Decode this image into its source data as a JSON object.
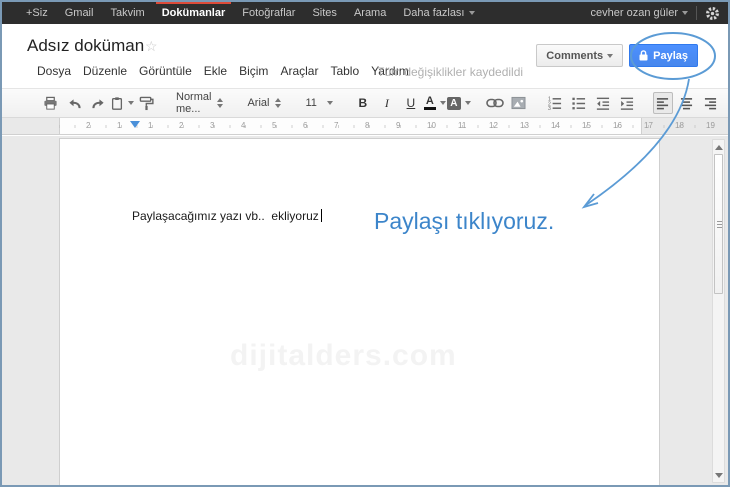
{
  "topbar": {
    "items": [
      {
        "label": "+Siz",
        "active": false,
        "caret": false
      },
      {
        "label": "Gmail",
        "active": false,
        "caret": false
      },
      {
        "label": "Takvim",
        "active": false,
        "caret": false
      },
      {
        "label": "Dokümanlar",
        "active": true,
        "caret": false
      },
      {
        "label": "Fotoğraflar",
        "active": false,
        "caret": false
      },
      {
        "label": "Sites",
        "active": false,
        "caret": false
      },
      {
        "label": "Arama",
        "active": false,
        "caret": false
      },
      {
        "label": "Daha fazlası",
        "active": false,
        "caret": true
      }
    ],
    "user_name": "cevher ozan güler",
    "gear_icon": "settings-gear"
  },
  "header": {
    "doc_title": "Adsız doküman",
    "star_icon": "☆",
    "menus": [
      "Dosya",
      "Düzenle",
      "Görüntüle",
      "Ekle",
      "Biçim",
      "Araçlar",
      "Tablo",
      "Yardım"
    ],
    "saved_status": "Tüm değişiklikler kaydedildi",
    "comments_label": "Comments",
    "share_label": "Paylaş",
    "share_lock_icon": "lock"
  },
  "toolbar": {
    "style_value": "Normal me...",
    "font_value": "Arial",
    "font_size_value": "11",
    "bold_label": "B",
    "italic_label": "I",
    "underline_label": "U",
    "text_color_label": "A",
    "highlight_label": "A"
  },
  "ruler": {
    "numbers": [
      "2",
      "1",
      "1",
      "2",
      "3",
      "4",
      "5",
      "6",
      "7",
      "8",
      "9",
      "10",
      "11",
      "12",
      "13",
      "14",
      "15",
      "16",
      "17",
      "18",
      "19"
    ]
  },
  "document": {
    "body_text": "Paylaşacağımız yazı vb..  ekliyoruz",
    "watermark": "dijitalders.com"
  },
  "annotation": {
    "callout_text": "Paylaşı tıklıyoruz.",
    "color": "#3c85ca"
  },
  "colors": {
    "share_button_blue": "#4d90fe",
    "active_tab_indicator_red": "#dd4b39",
    "annotation_blue": "#3c85ca",
    "topbar_background": "#2d2d2d"
  }
}
